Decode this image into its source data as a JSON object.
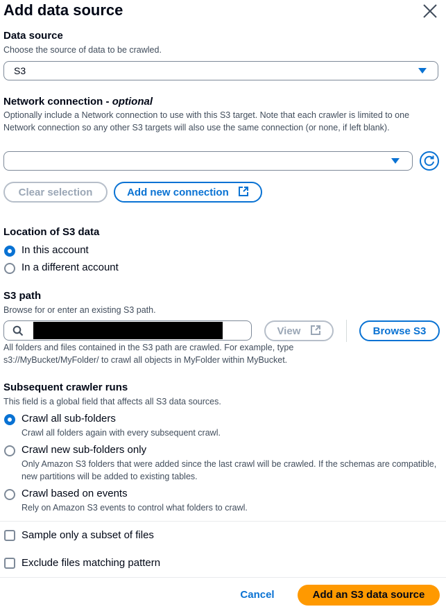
{
  "header": {
    "title": "Add data source",
    "close_icon": "close-icon"
  },
  "data_source": {
    "label": "Data source",
    "description": "Choose the source of data to be crawled.",
    "selected": "S3"
  },
  "network": {
    "label": "Network connection - ",
    "label_optional": "optional",
    "description": "Optionally include a Network connection to use with this S3 target. Note that each crawler is limited to one Network connection so any other S3 targets will also use the same connection (or none, if left blank).",
    "selected": "",
    "refresh_icon": "refresh-icon",
    "clear_label": "Clear selection",
    "add_label": "Add new connection"
  },
  "location": {
    "label": "Location of S3 data",
    "options": [
      {
        "label": "In this account",
        "selected": true
      },
      {
        "label": "In a different account",
        "selected": false
      }
    ]
  },
  "s3_path": {
    "label": "S3 path",
    "description": "Browse for or enter an existing S3 path.",
    "value": "",
    "view_label": "View",
    "browse_label": "Browse S3",
    "help": "All folders and files contained in the S3 path are crawled. For example, type s3://MyBucket/MyFolder/ to crawl all objects in MyFolder within MyBucket."
  },
  "subsequent": {
    "label": "Subsequent crawler runs",
    "description": "This field is a global field that affects all S3 data sources.",
    "options": [
      {
        "label": "Crawl all sub-folders",
        "desc": "Crawl all folders again with every subsequent crawl.",
        "selected": true
      },
      {
        "label": "Crawl new sub-folders only",
        "desc": "Only Amazon S3 folders that were added since the last crawl will be crawled. If the schemas are compatible, new partitions will be added to existing tables.",
        "selected": false
      },
      {
        "label": "Crawl based on events",
        "desc": "Rely on Amazon S3 events to control what folders to crawl.",
        "selected": false
      }
    ]
  },
  "checkboxes": [
    {
      "label": "Sample only a subset of files",
      "checked": false
    },
    {
      "label": "Exclude files matching pattern",
      "checked": false
    }
  ],
  "footer": {
    "cancel_label": "Cancel",
    "submit_label": "Add an S3 data source"
  },
  "colors": {
    "accent": "#0972d3",
    "primary": "#ff9900",
    "text": "#000716",
    "muted": "#414d5c"
  }
}
